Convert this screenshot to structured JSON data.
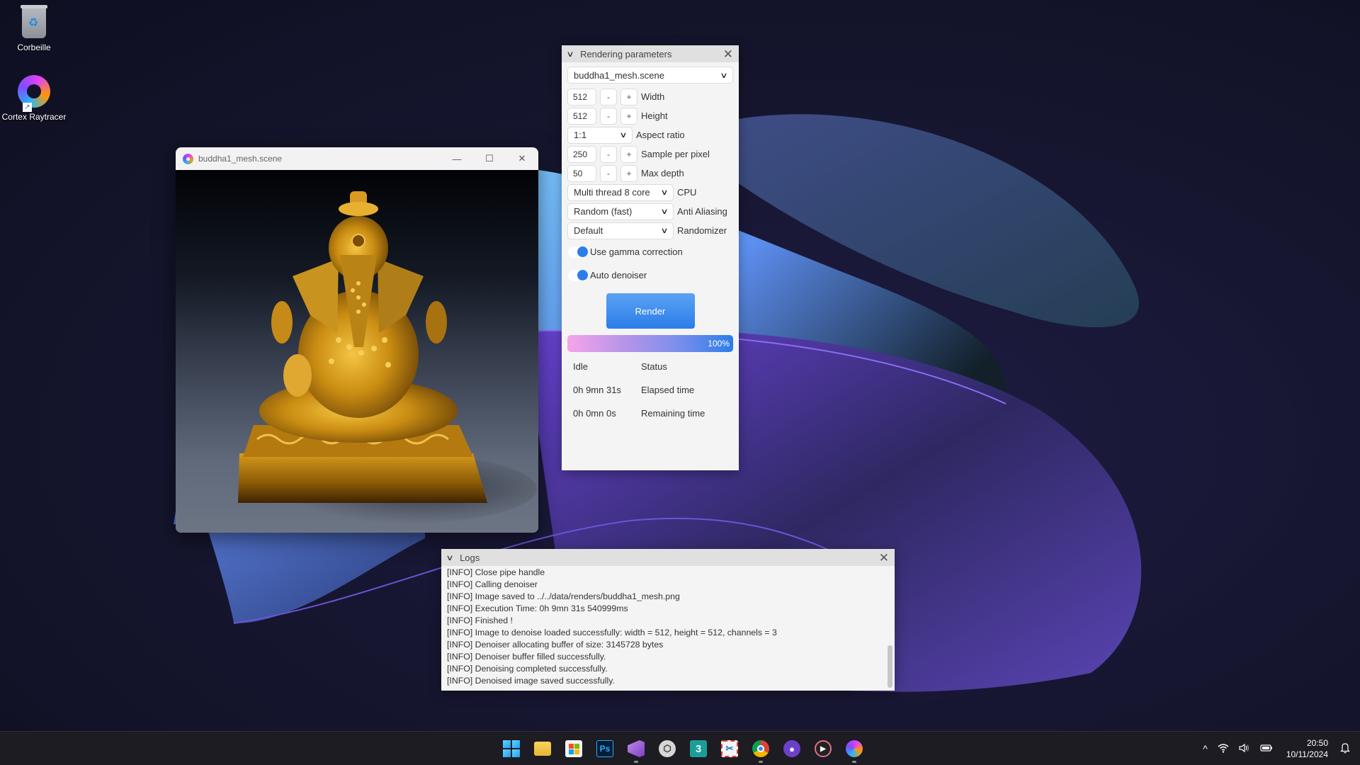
{
  "desktop": {
    "icons": [
      {
        "label": "Corbeille",
        "icon": "recycle-bin-icon"
      },
      {
        "label": "Cortex Raytracer",
        "icon": "cortex-raytracer-icon"
      }
    ]
  },
  "render_window": {
    "title": "buddha1_mesh.scene",
    "controls": {
      "minimize": "—",
      "maximize": "☐",
      "close": "✕"
    }
  },
  "params_panel": {
    "title": "Rendering parameters",
    "scene_select": "buddha1_mesh.scene",
    "width": {
      "value": "512",
      "label": "Width"
    },
    "height": {
      "value": "512",
      "label": "Height"
    },
    "aspect_ratio": {
      "value": "1:1",
      "label": "Aspect ratio"
    },
    "spp": {
      "value": "250",
      "label": "Sample per pixel"
    },
    "max_depth": {
      "value": "50",
      "label": "Max depth"
    },
    "cpu": {
      "value": "Multi thread 8 core",
      "label": "CPU"
    },
    "anti_aliasing": {
      "value": "Random (fast)",
      "label": "Anti Aliasing"
    },
    "randomizer": {
      "value": "Default",
      "label": "Randomizer"
    },
    "gamma": {
      "label": "Use gamma correction",
      "enabled": true
    },
    "denoiser": {
      "label": "Auto denoiser",
      "enabled": true
    },
    "minus": "-",
    "plus": "+",
    "render_label": "Render",
    "progress": {
      "percent": 100,
      "text": "100%"
    },
    "status": [
      {
        "value": "Idle",
        "label": "Status"
      },
      {
        "value": "0h 9mn 31s",
        "label": "Elapsed time"
      },
      {
        "value": "0h 0mn 0s",
        "label": "Remaining time"
      }
    ]
  },
  "logs_panel": {
    "title": "Logs",
    "lines": [
      "[INFO] Close pipe handle",
      "[INFO] Calling denoiser",
      "[INFO] Image saved to ../../data/renders/buddha1_mesh.png",
      "[INFO] Execution Time: 0h 9mn 31s 540999ms",
      "[INFO] Finished !",
      "[INFO] Image to denoise loaded successfully: width = 512, height = 512, channels = 3",
      "[INFO] Denoiser allocating buffer of size: 3145728 bytes",
      "[INFO] Denoiser buffer filled successfully.",
      "[INFO] Denoising completed successfully.",
      "[INFO] Denoised image saved successfully."
    ]
  },
  "taskbar": {
    "apps": [
      {
        "name": "start",
        "icon": "windows-start-icon",
        "running": false
      },
      {
        "name": "file-explorer",
        "icon": "folder-icon",
        "running": false
      },
      {
        "name": "microsoft-store",
        "icon": "store-icon",
        "running": false
      },
      {
        "name": "photoshop",
        "icon": "photoshop-icon",
        "label": "Ps",
        "running": false
      },
      {
        "name": "visual-studio",
        "icon": "visual-studio-icon",
        "running": true
      },
      {
        "name": "unity",
        "icon": "unity-icon",
        "running": false
      },
      {
        "name": "3ds-max",
        "icon": "3dsmax-icon",
        "label": "3",
        "running": false
      },
      {
        "name": "snipping-tool",
        "icon": "snipping-tool-icon",
        "running": false
      },
      {
        "name": "chrome",
        "icon": "chrome-icon",
        "running": true
      },
      {
        "name": "github-desktop",
        "icon": "github-icon",
        "running": false
      },
      {
        "name": "media-player",
        "icon": "media-player-icon",
        "running": false
      },
      {
        "name": "cortex-raytracer",
        "icon": "cortex-raytracer-icon",
        "running": true
      }
    ],
    "tray": {
      "chevron": "^",
      "time": "20:50",
      "date": "10/11/2024"
    }
  },
  "colors": {
    "accent": "#2b7de9",
    "panel_bg": "#f4f4f4",
    "panel_header": "#e0e0e0",
    "taskbar": "#1c1c22"
  }
}
